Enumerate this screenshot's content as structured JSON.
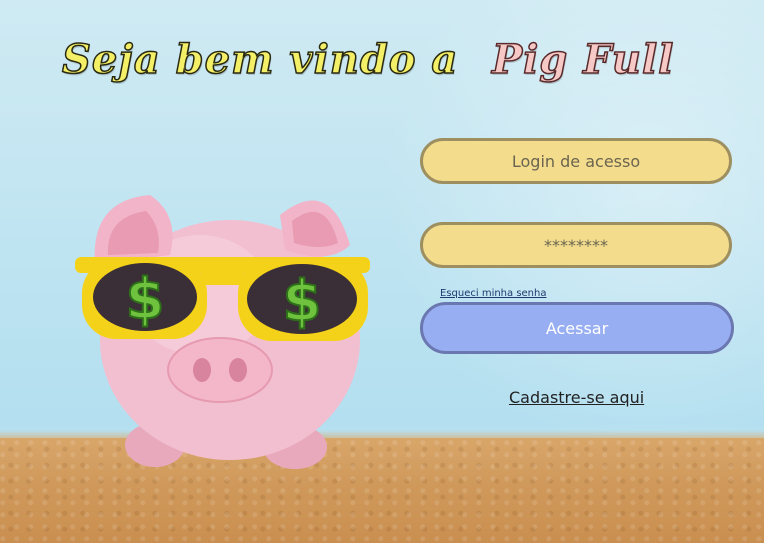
{
  "header": {
    "welcome_text": "Seja bem vindo a",
    "brand_name": "Pig Full"
  },
  "illustration": {
    "subject": "piggy-bank-with-sunglasses",
    "lens_symbol": "$"
  },
  "login_form": {
    "login_placeholder": "Login de acesso",
    "password_placeholder": "********",
    "forgot_password_label": "Esqueci minha senha",
    "submit_label": "Acessar",
    "signup_label": "Cadastre-se aqui"
  },
  "colors": {
    "field_fill": "#f3dd8d",
    "field_border": "#9d8f5f",
    "button_fill": "#98aef2",
    "button_border": "#6b77b0",
    "welcome_text": "#f3ef67",
    "brand_text": "#f6c9c7"
  }
}
